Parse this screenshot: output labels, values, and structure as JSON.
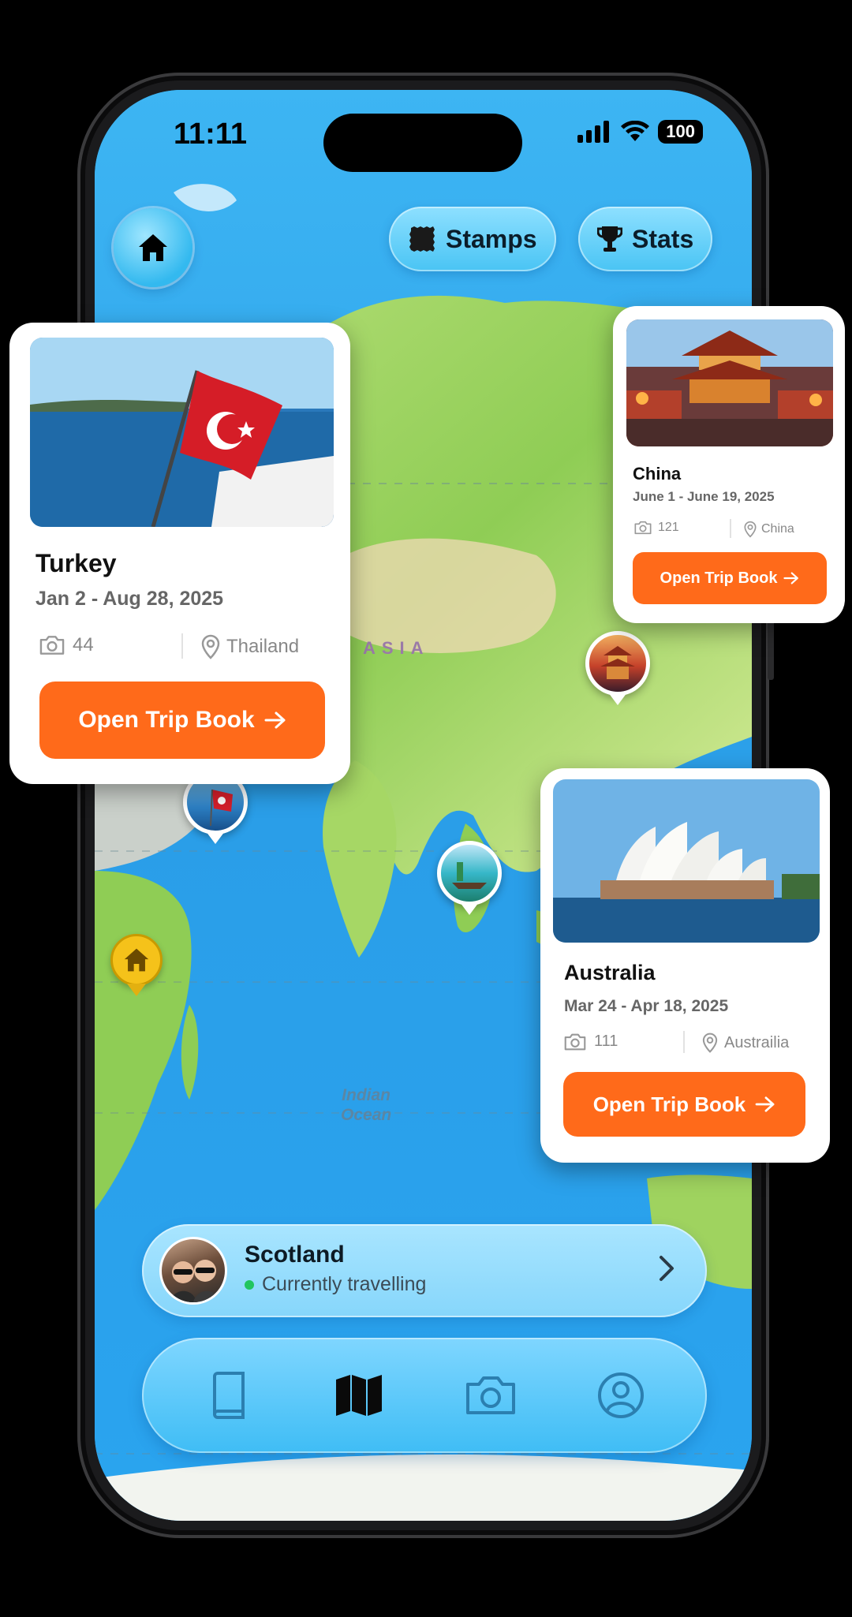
{
  "status": {
    "time": "11:11",
    "battery": "100"
  },
  "top_buttons": {
    "stamps_label": "Stamps",
    "stats_label": "Stats"
  },
  "map": {
    "region_label": "ASIA",
    "ocean_label_line1": "Indian",
    "ocean_label_line2": "Ocean"
  },
  "trips": [
    {
      "country": "Turkey",
      "dates": "Jan 2 - Aug 28, 2025",
      "photos": "44",
      "location": "Thailand",
      "cta": "Open Trip Book"
    },
    {
      "country": "China",
      "dates": "June 1 - June 19, 2025",
      "photos": "121",
      "location": "China",
      "cta": "Open Trip Book"
    },
    {
      "country": "Australia",
      "dates": "Mar 24 - Apr 18, 2025",
      "photos": "111",
      "location": "Austrailia",
      "cta": "Open Trip Book"
    }
  ],
  "current": {
    "title": "Scotland",
    "subtitle": "Currently travelling"
  },
  "tabs": [
    {
      "name": "book-icon"
    },
    {
      "name": "map-icon",
      "active": true
    },
    {
      "name": "camera-icon"
    },
    {
      "name": "profile-icon"
    }
  ],
  "colors": {
    "accent": "#ff6a1a",
    "ocean": "#2aa8f2",
    "land": "#9ad35c",
    "status_dot": "#22c55e"
  }
}
